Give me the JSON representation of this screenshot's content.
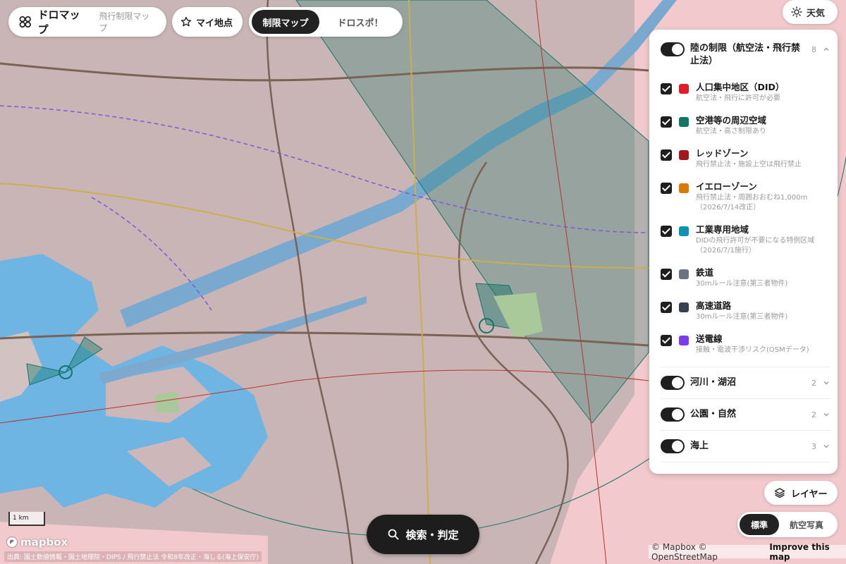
{
  "header": {
    "brand_title": "ドロマップ",
    "brand_subtitle": "飛行制限マップ",
    "myspot_label": "マイ地点",
    "modes": [
      "制限マップ",
      "ドロスポ！"
    ],
    "active_mode": "制限マップ",
    "weather_label": "天気"
  },
  "panel": {
    "land_group": {
      "title": "陸の制限（航空法・飛行禁止法）",
      "count": "8",
      "expanded": true,
      "enabled": true
    },
    "layers": [
      {
        "name": "人口集中地区（DID）",
        "desc": "航空法・飛行に許可が必要",
        "color": "#e11d2a",
        "checked": true
      },
      {
        "name": "空港等の周辺空域",
        "desc": "航空法・高さ制限あり",
        "color": "#127566",
        "checked": true
      },
      {
        "name": "レッドゾーン",
        "desc": "飛行禁止法・施設上空は飛行禁止",
        "color": "#a4171d",
        "checked": true
      },
      {
        "name": "イエローゾーン",
        "desc": "飛行禁止法・周囲おおむね1,000m（2026/7/14改正）",
        "color": "#d97a06",
        "checked": true
      },
      {
        "name": "工業専用地域",
        "desc": "DIDの飛行許可が不要になる特例区域（2026/7/1施行）",
        "color": "#0e93b2",
        "checked": true
      },
      {
        "name": "鉄道",
        "desc": "30mルール注意(第三者物件)",
        "color": "#6b7280",
        "checked": true
      },
      {
        "name": "高速道路",
        "desc": "30mルール注意(第三者物件)",
        "color": "#374151",
        "checked": true
      },
      {
        "name": "送電線",
        "desc": "接触・電波干渉リスク(OSMデータ)",
        "color": "#7c3aed",
        "checked": true
      }
    ],
    "collapsed_groups": [
      {
        "title": "河川・湖沼",
        "count": "2",
        "enabled": true
      },
      {
        "title": "公園・自然",
        "count": "2",
        "enabled": true
      },
      {
        "title": "海上",
        "count": "3",
        "enabled": true
      }
    ]
  },
  "controls": {
    "layer_button": "レイヤー",
    "basemaps": [
      "標準",
      "航空写真"
    ],
    "active_basemap": "標準",
    "search_button": "検索・判定",
    "scale_label": "1 km"
  },
  "footer": {
    "mapbox_logo": "mapbox",
    "source_text": "出典: 国土数値情報・国土地理院・DIPS / 飛行禁止法 令和8年改正・海しる(海上保安庁)",
    "attribution": "© Mapbox © OpenStreetMap",
    "improve_link": "Improve this map"
  },
  "colors": {
    "land_did": "#c9b5b6",
    "outside_did": "#f2c9cc",
    "water": "#6fb5e3",
    "river": "#79a9cf",
    "airport_zone": "#127566",
    "park": "#a9c99a",
    "accent_dark": "#1d1d1d"
  }
}
